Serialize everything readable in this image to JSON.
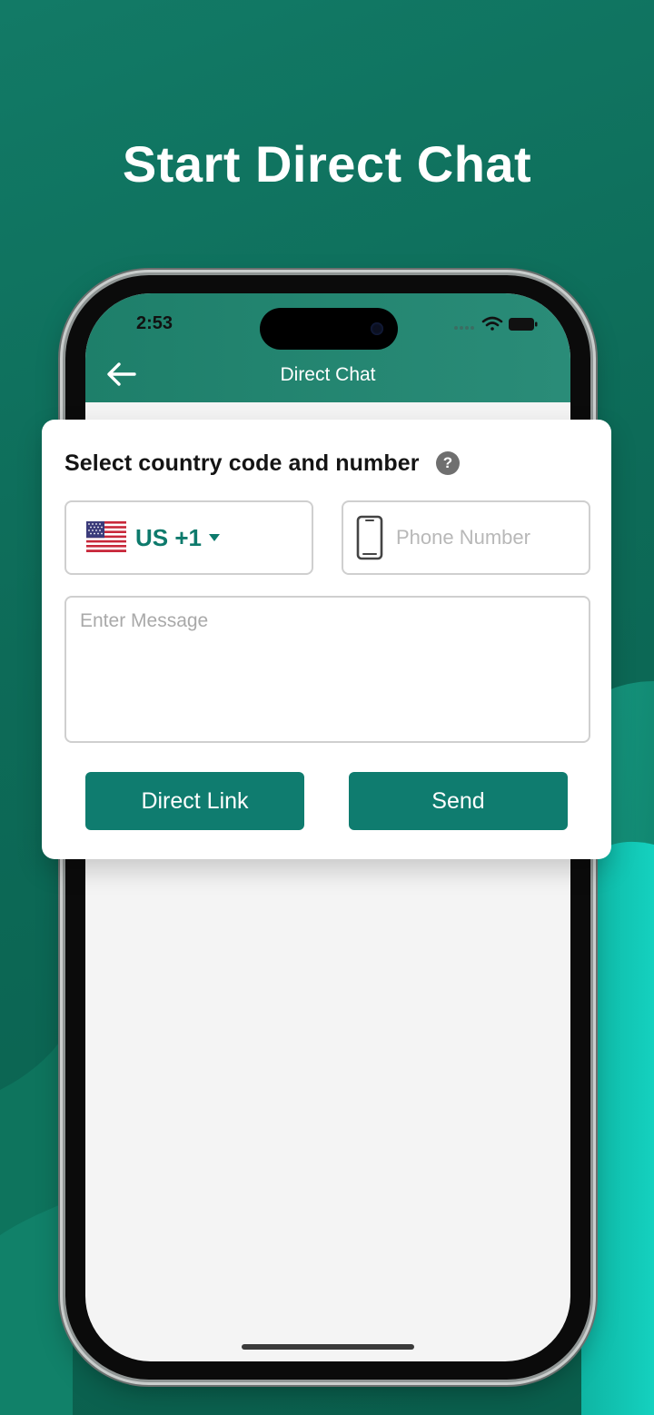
{
  "headline": "Start Direct Chat",
  "status_bar": {
    "time": "2:53"
  },
  "app_bar": {
    "title": "Direct Chat",
    "back_icon": "arrow-left-icon"
  },
  "form": {
    "title": "Select country code and number",
    "help_icon_glyph": "?",
    "country": {
      "flag": "us-flag-icon",
      "code_label": "US +1"
    },
    "phone_placeholder": "Phone Number",
    "message_placeholder": "Enter Message",
    "buttons": {
      "direct_link": "Direct Link",
      "send": "Send"
    }
  },
  "colors": {
    "background": "#0d6b58",
    "app_bar": "#2a8c78",
    "accent": "#0f7c6f",
    "accent_text": "#0d7a6c",
    "bright_wave": "#11c4b3"
  }
}
